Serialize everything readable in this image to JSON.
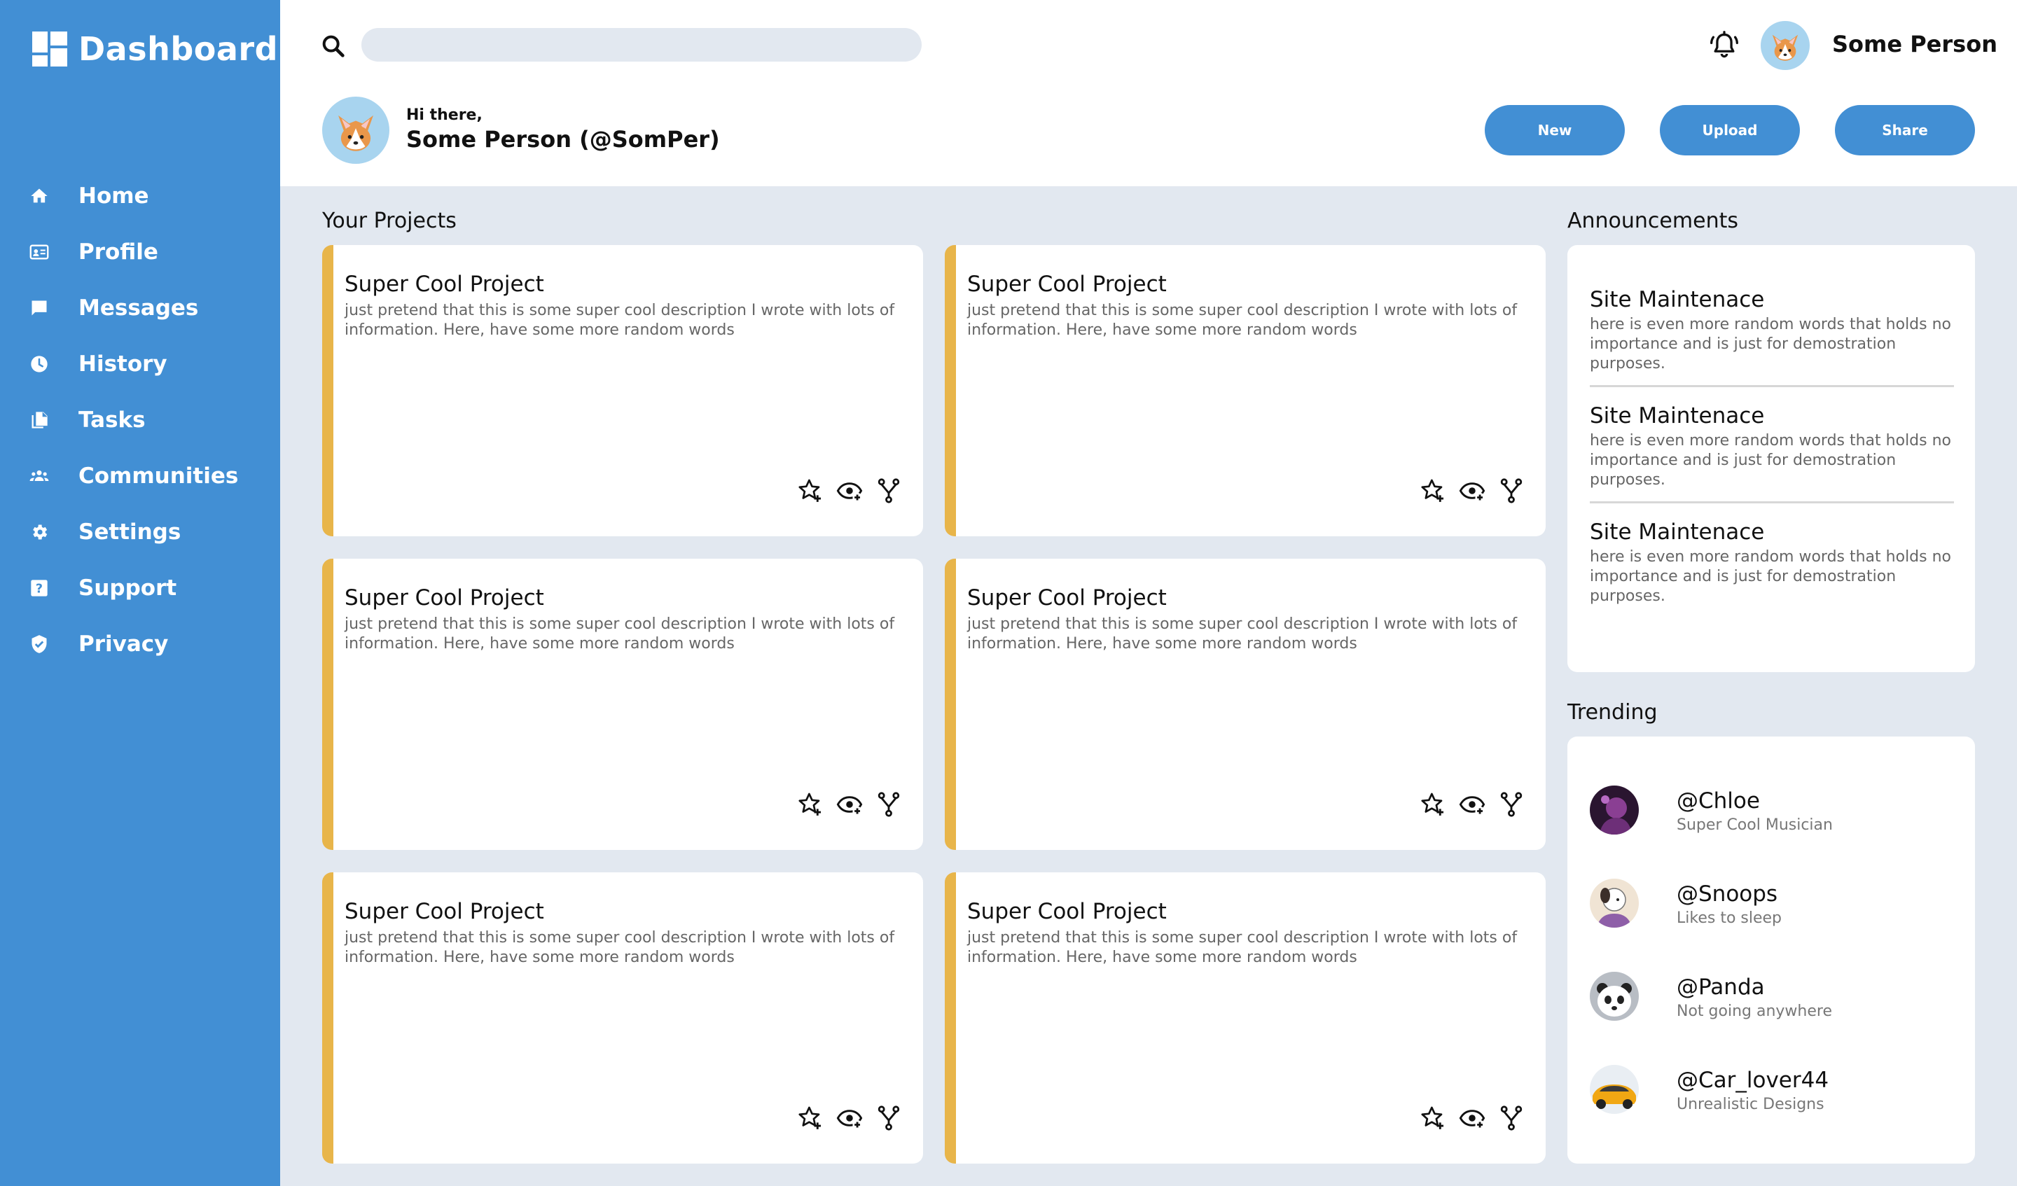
{
  "app": {
    "title": "Dashboard"
  },
  "sidebar": {
    "items": [
      {
        "label": "Home",
        "icon": "home-icon"
      },
      {
        "label": "Profile",
        "icon": "id-card-icon"
      },
      {
        "label": "Messages",
        "icon": "chat-icon"
      },
      {
        "label": "History",
        "icon": "clock-icon"
      },
      {
        "label": "Tasks",
        "icon": "documents-icon"
      },
      {
        "label": "Communities",
        "icon": "people-icon"
      },
      {
        "label": "Settings",
        "icon": "gear-icon"
      },
      {
        "label": "Support",
        "icon": "help-icon"
      },
      {
        "label": "Privacy",
        "icon": "shield-icon"
      }
    ]
  },
  "header": {
    "search_placeholder": "",
    "username": "Some Person",
    "greeting": "Hi there,",
    "greeting_name": "Some Person (@SomPer)",
    "buttons": {
      "new": "New",
      "upload": "Upload",
      "share": "Share"
    }
  },
  "projects": {
    "section_title": "Your Projects",
    "items": [
      {
        "title": "Super Cool Project",
        "description": "just pretend that this is some super cool description I wrote with lots of information. Here, have some more random words"
      },
      {
        "title": "Super Cool Project",
        "description": "just pretend that this is some super cool description I wrote with lots of information. Here, have some more random words"
      },
      {
        "title": "Super Cool Project",
        "description": "just pretend that this is some super cool description I wrote with lots of information. Here, have some more random words"
      },
      {
        "title": "Super Cool Project",
        "description": "just pretend that this is some super cool description I wrote with lots of information. Here, have some more random words"
      },
      {
        "title": "Super Cool Project",
        "description": "just pretend that this is some super cool description I wrote with lots of information. Here, have some more random words"
      },
      {
        "title": "Super Cool Project",
        "description": "just pretend that this is some super cool description I wrote with lots of information. Here, have some more random words"
      }
    ]
  },
  "announcements": {
    "section_title": "Announcements",
    "items": [
      {
        "title": "Site Maintenace",
        "description": "here is even more random words that holds no importance and is just for demostration purposes."
      },
      {
        "title": "Site Maintenace",
        "description": "here is even more random words that holds no importance and is just for demostration purposes."
      },
      {
        "title": "Site Maintenace",
        "description": "here is even more random words that holds no importance and is just for demostration purposes."
      }
    ]
  },
  "trending": {
    "section_title": "Trending",
    "items": [
      {
        "handle": "@Chloe",
        "subtitle": "Super Cool Musician"
      },
      {
        "handle": "@Snoops",
        "subtitle": "Likes to sleep"
      },
      {
        "handle": "@Panda",
        "subtitle": "Not going anywhere"
      },
      {
        "handle": "@Car_lover44",
        "subtitle": "Unrealistic Designs"
      }
    ]
  },
  "colors": {
    "primary": "#428fd4",
    "accent": "#e8b54a",
    "background": "#e2e8f0"
  }
}
